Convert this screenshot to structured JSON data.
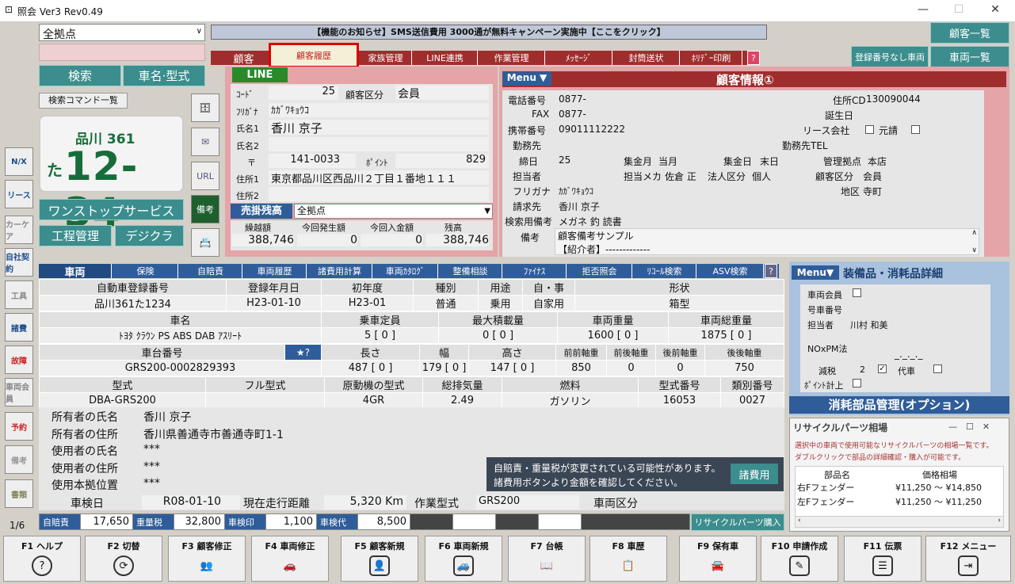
{
  "app": {
    "title": "照会 Ver3 Rev0.49",
    "win_min": "—",
    "win_max": "☐",
    "win_close": "✕"
  },
  "top": {
    "store": "全拠点",
    "notice": "【機能のお知らせ】SMS送信費用 3000通が無料キャンペーン実施中【ここをクリック】",
    "customer_list": "顧客一覧",
    "vehicle_list": "車両一覧",
    "no_reg": "登録番号なし車両",
    "search": "検索",
    "model": "車名·型式",
    "search_cmd": "検索コマンド一覧"
  },
  "tabs": [
    {
      "label": "顧客"
    },
    {
      "label": "顧客履歴"
    },
    {
      "label": "家族管理"
    },
    {
      "label": "LINE連携"
    },
    {
      "label": "作業管理"
    },
    {
      "label": "ﾒｯｾｰｼﾞ"
    },
    {
      "label": "封筒送状"
    },
    {
      "label": "ﾎﾘﾃﾞｰ印刷"
    },
    {
      "label": "?"
    }
  ],
  "plate": {
    "region": "品川 361",
    "kana": "た",
    "number": "12-34"
  },
  "left_buttons": {
    "onestop": "ワンストップサービス",
    "process": "工程管理",
    "digicra": "デジクラ"
  },
  "line_badge": "LINE",
  "small_icons": {
    "url": "URL",
    "note": "備考"
  },
  "side_icons": [
    "N/X",
    "リース",
    "カーケア",
    "自社契約",
    "工具",
    "諸費",
    "故障",
    "車両会員",
    "予約",
    "備考",
    "書類"
  ],
  "page_indicator": "1/6",
  "customer": {
    "rows": [
      {
        "label": "ｺｰﾄﾞ",
        "value": "25",
        "label2": "顧客区分",
        "value2": "会員"
      },
      {
        "label": "ﾌﾘｶﾞﾅ",
        "value": "ｶｶﾞﾜｷｮｳｺ"
      },
      {
        "label": "氏名1",
        "value": "香川 京子"
      },
      {
        "label": "氏名2",
        "value": ""
      },
      {
        "label": "〒",
        "value": "141-0033",
        "label2": "ﾎﾟｲﾝﾄ",
        "value2": "829"
      },
      {
        "label": "住所1",
        "value": "東京都品川区西品川２丁目１番地１１１"
      },
      {
        "label": "住所2",
        "value": ""
      }
    ],
    "ar_label": "売掛残高",
    "ar_store": "全拠点",
    "ar_headers": [
      "繰越額",
      "今回発生額",
      "今回入金額",
      "残高"
    ],
    "ar_values": [
      "388,746",
      "0",
      "0",
      "388,746"
    ]
  },
  "cinfo": {
    "menu": "Menu ▼",
    "title": "顧客情報①",
    "phone_l": "電話番号",
    "phone": "0877-",
    "jcd_l": "住所CD",
    "jcd": "130090044",
    "fax_l": "FAX",
    "fax": "0877-",
    "bday_l": "誕生日",
    "mobile_l": "携帯番号",
    "mobile": "09011112222",
    "lease_l": "リース会社",
    "moto_l": "元請",
    "work_l": "勤務先",
    "worktel_l": "勤務先TEL",
    "cutoff_l": "締日",
    "cutoff": "25",
    "collect_l": "集金月",
    "collect": "当月",
    "collect_day_l": "集金日",
    "collect_day": "末日",
    "base_l": "管理拠点",
    "base": "本店",
    "staff_l": "担当者",
    "staffm_l": "担当メカ",
    "staffm": "佐倉 正",
    "corp_l": "法人区分",
    "corp": "個人",
    "ckind_l": "顧客区分",
    "ckind": "会員",
    "kana_l": "フリガナ",
    "kana": "ｶｶﾞﾜｷｮｳｺ",
    "area_l": "地区",
    "area": "寺町",
    "bill_l": "請求先",
    "bill": "香川 京子",
    "srch_l": "検索用備考",
    "srch": "メガネ 釣 読書",
    "memo_l": "備考",
    "memo1": "顧客備考サンプル",
    "memo2": "【紹介者】-------------"
  },
  "vtabs": [
    "車両",
    "保険",
    "自賠責",
    "車両履歴",
    "諸費用計算",
    "車両ｶﾀﾛｸﾞ",
    "整備相談",
    "ﾌｧｲﾅｽ",
    "拒否照会",
    "ﾘｺｰﾙ検索",
    "ASV検索",
    "?"
  ],
  "vehicle": {
    "h1": [
      "自動車登録番号",
      "登録年月日",
      "初年度",
      "種別",
      "用途",
      "自・事",
      "形状"
    ],
    "v1": [
      "品川361た1234",
      "H23-01-10",
      "H23-01",
      "普通",
      "乗用",
      "自家用",
      "箱型"
    ],
    "h2": [
      "車名",
      "乗車定員",
      "最大積載量",
      "車両重量",
      "車両総重量"
    ],
    "v2": [
      "ﾄﾖﾀ ｸﾗｳﾝ PS ABS DAB ｱｽﾘｰﾄ",
      "5 [ 0 ]",
      "0 [ 0 ]",
      "1600 [ 0 ]",
      "1875 [ 0 ]"
    ],
    "h3": [
      "車台番号",
      "★?",
      "長さ",
      "幅",
      "高さ",
      "前前軸重",
      "前後軸重",
      "後前軸重",
      "後後軸重"
    ],
    "v3": [
      "GRS200-0002829393",
      "487 [ 0 ]",
      "179 [ 0 ]",
      "147 [ 0 ]",
      "850",
      "0",
      "0",
      "750"
    ],
    "h4": [
      "型式",
      "フル型式",
      "原動機の型式",
      "総排気量",
      "燃料",
      "型式番号",
      "類別番号"
    ],
    "v4": [
      "DBA-GRS200",
      "",
      "4GR",
      "2.49",
      "ガソリン",
      "16053",
      "0027"
    ],
    "owner_name_l": "所有者の氏名",
    "owner_name": "香川 京子",
    "owner_addr_l": "所有者の住所",
    "owner_addr": "香川県善通寺市善通寺町1-1",
    "user_name_l": "使用者の氏名",
    "user_name": "***",
    "user_addr_l": "使用者の住所",
    "user_addr": "***",
    "base_l": "使用本拠位置",
    "base": "***",
    "inspect_l": "車検日",
    "inspect": "R08-01-10",
    "mileage_l": "現在走行距離",
    "mileage": "5,320 Km",
    "work_l": "作業型式",
    "work": "GRS200",
    "vclass_l": "車両区分"
  },
  "warning": {
    "text1": "自賠責・重量税が変更されている可能性があります。",
    "text2": "諸費用ボタンより金額を確認してください。",
    "button": "諸費用"
  },
  "fees": {
    "jibai_l": "自賠責",
    "jibai": "17,650",
    "weight_l": "重量税",
    "weight": "32,800",
    "stamp_l": "車検印",
    "stamp": "1,100",
    "daiko_l": "車検代",
    "daiko": "8,500",
    "recycle": "リサイクルパーツ購入"
  },
  "equip": {
    "menu": "Menu▼",
    "title": "装備品・消耗品詳細",
    "member_l": "車両会員",
    "no_l": "号車番号",
    "staff_l": "担当者",
    "staff": "川村 和美",
    "nox_l": "NOxPM法",
    "nox": "_._._._",
    "tax_l": "減税",
    "tax": "2",
    "daisha_l": "代車",
    "point_l": "ﾎﾟｲﾝﾄ計上",
    "parts_title": "消耗部品管理(オプション)"
  },
  "recycle": {
    "title": "リサイクルパーツ相場",
    "desc1": "選択中の車両で使用可能なリサイクルパーツの相場一覧です。",
    "desc2": "ダブルクリックで部品の詳細確認・購入が可能です。",
    "col1": "部品名",
    "col2": "価格相場",
    "rows": [
      {
        "name": "右Fフェンダー",
        "price": "¥11,250 ～ ¥14,850"
      },
      {
        "name": "左Fフェンダー",
        "price": "¥11,250 ～ ¥11,250"
      }
    ]
  },
  "fkeys": [
    {
      "label": "F1 ヘルプ",
      "icon": "?"
    },
    {
      "label": "F2 切替",
      "icon": "⟳"
    },
    {
      "label": "F3 顧客修正",
      "icon": "👥"
    },
    {
      "label": "F4 車両修正",
      "icon": "🚗"
    },
    {
      "label": "F5 顧客新規",
      "icon": "👤"
    },
    {
      "label": "F6 車両新規",
      "icon": "🚙"
    },
    {
      "label": "F7 台帳",
      "icon": "📖"
    },
    {
      "label": "F8 車歴",
      "icon": "📋"
    },
    {
      "label": "F9 保有車",
      "icon": "🚘"
    },
    {
      "label": "F10 申請作成",
      "icon": "✎"
    },
    {
      "label": "F11 伝票",
      "icon": "☰"
    },
    {
      "label": "F12 メニュー",
      "icon": "⇥"
    }
  ]
}
